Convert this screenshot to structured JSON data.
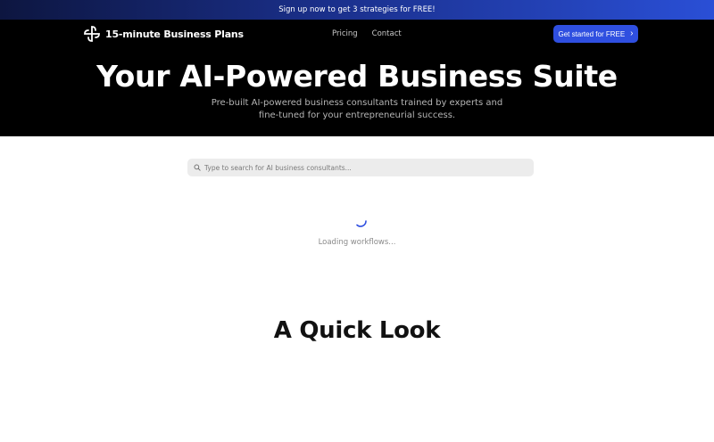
{
  "promo": {
    "text": "Sign up now to get 3 strategies for FREE!"
  },
  "nav": {
    "logo_text": "15-minute Business Plans",
    "logo_icon": "pinwheel-logo-icon",
    "links": [
      "Pricing",
      "Contact"
    ],
    "cta_label": "Get started for FREE",
    "cta_icon": "chevron-right-icon"
  },
  "hero": {
    "title": "Your AI-Powered Business Suite",
    "subtitle": "Pre-built AI-powered business consultants trained by experts and fine-tuned for your entrepreneurial success."
  },
  "search": {
    "placeholder": "Type to search for AI business consultants...",
    "value": "",
    "icon": "search-icon"
  },
  "loading": {
    "text": "Loading workflows...",
    "icon": "spinner-icon"
  },
  "section": {
    "title": "A Quick Look"
  },
  "colors": {
    "accent": "#2f4fe0",
    "hero_bg": "#000000",
    "promo_start": "#0d1640",
    "promo_end": "#2a4fd6"
  }
}
